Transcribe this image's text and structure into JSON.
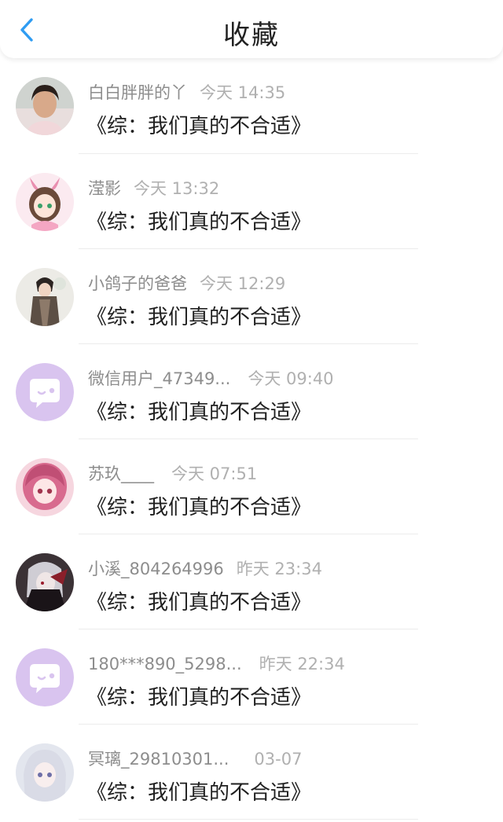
{
  "header": {
    "title": "收藏",
    "accent_color": "#2f9cf2"
  },
  "items": [
    {
      "name": "白白胖胖的丫",
      "time": "今天 14:35",
      "content": "《综：我们真的不合适》",
      "avatar": "photo-child"
    },
    {
      "name": "滢影",
      "time": "今天 13:32",
      "content": "《综：我们真的不合适》",
      "avatar": "anime-pink-bunny"
    },
    {
      "name": "小鸽子的爸爸",
      "time": "今天 12:29",
      "content": "《综：我们真的不合适》",
      "avatar": "anime-dark-hair"
    },
    {
      "name": "微信用户_47349...",
      "time": "今天 09:40",
      "content": "《综：我们真的不合适》",
      "avatar": "default-chat-bubble"
    },
    {
      "name": "苏玖____",
      "time": "今天 07:51",
      "content": "《综：我们真的不合适》",
      "avatar": "anime-pink-girl"
    },
    {
      "name": "小溪_804264996",
      "time": "昨天 23:34",
      "content": "《综：我们真的不合适》",
      "avatar": "anime-dark-red"
    },
    {
      "name": "180***890_5298...",
      "time": "昨天 22:34",
      "content": "《综：我们真的不合适》",
      "avatar": "default-chat-bubble"
    },
    {
      "name": "冥璃_29810301...",
      "time": "03-07",
      "content": "《综：我们真的不合适》",
      "avatar": "anime-silver-hair"
    }
  ],
  "colors": {
    "default_avatar_bg": "#d9c4ef",
    "name_text": "#8d8d8d",
    "time_text": "#b0b0b0"
  }
}
